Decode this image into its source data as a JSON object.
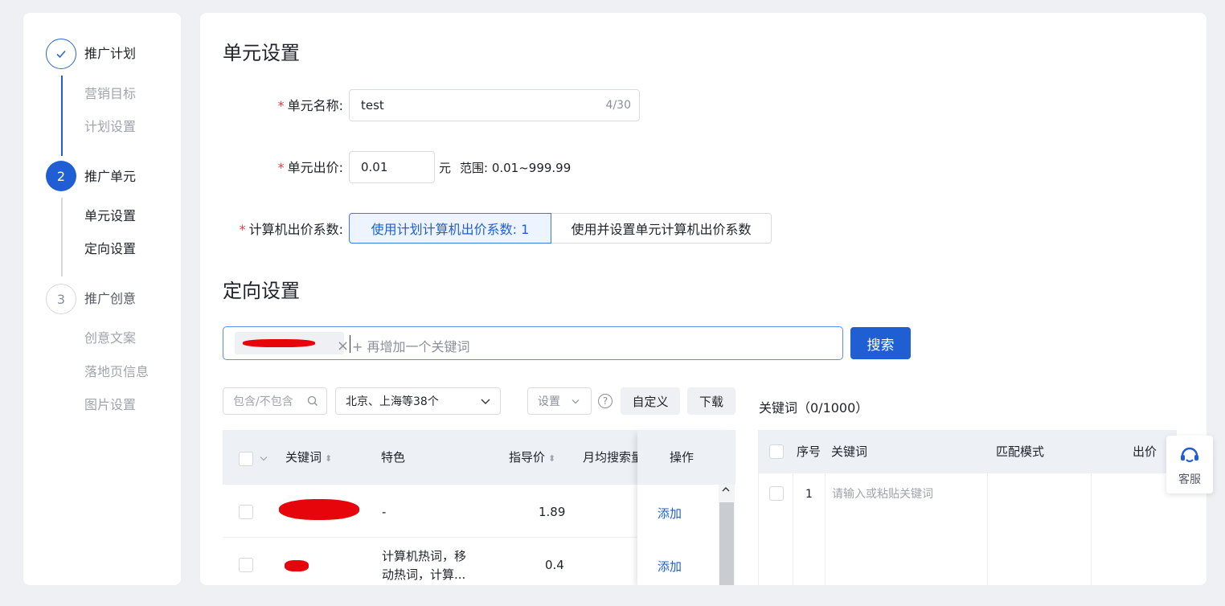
{
  "steps": [
    {
      "index": "✓",
      "title": "推广计划",
      "subs": [
        "营销目标",
        "计划设置"
      ]
    },
    {
      "index": "2",
      "title": "推广单元",
      "subs": [
        "单元设置",
        "定向设置"
      ]
    },
    {
      "index": "3",
      "title": "推广创意",
      "subs": [
        "创意文案",
        "落地页信息",
        "图片设置"
      ]
    }
  ],
  "unit_settings": {
    "title": "单元设置",
    "name_label": "单元名称:",
    "name_value": "test",
    "name_counter": "4/30",
    "bid_label": "单元出价:",
    "bid_value": "0.01",
    "bid_unit": "元",
    "bid_range": "范围: 0.01~999.99",
    "coef_label": "计算机出价系数:",
    "coef_option_plan": "使用计划计算机出价系数: 1",
    "coef_option_unit": "使用并设置单元计算机出价系数",
    "required_mark": "*"
  },
  "targeting": {
    "title": "定向设置",
    "keyword_placeholder": "+ 再增加一个关键词",
    "tag_close": "×",
    "search_button": "搜索",
    "filter_placeholder": "包含/不包含",
    "region_value": "北京、上海等38个",
    "settings_label": "设置",
    "help": "?",
    "custom_button": "自定义",
    "download_button": "下载"
  },
  "left_table": {
    "headers": {
      "keyword": "关键词",
      "feature": "特色",
      "price": "指导价",
      "monthly": "月均搜索量",
      "action": "操作"
    },
    "rows": [
      {
        "feature": "-",
        "price": "1.89",
        "action": "添加"
      },
      {
        "feature": "计算机热词，移动热词，计算...",
        "price": "0.4",
        "action": "添加"
      }
    ]
  },
  "right_table": {
    "title": "关键词（0/1000）",
    "headers": {
      "index": "序号",
      "keyword": "关键词",
      "match": "匹配模式",
      "bid": "出价"
    },
    "rows": [
      {
        "index": "1",
        "keyword_placeholder": "请输入或粘贴关键词"
      }
    ]
  },
  "service": {
    "label": "客服"
  },
  "colors": {
    "primary": "#1f5fd3",
    "required": "#e63b3b",
    "redaction": "#e5050a"
  }
}
